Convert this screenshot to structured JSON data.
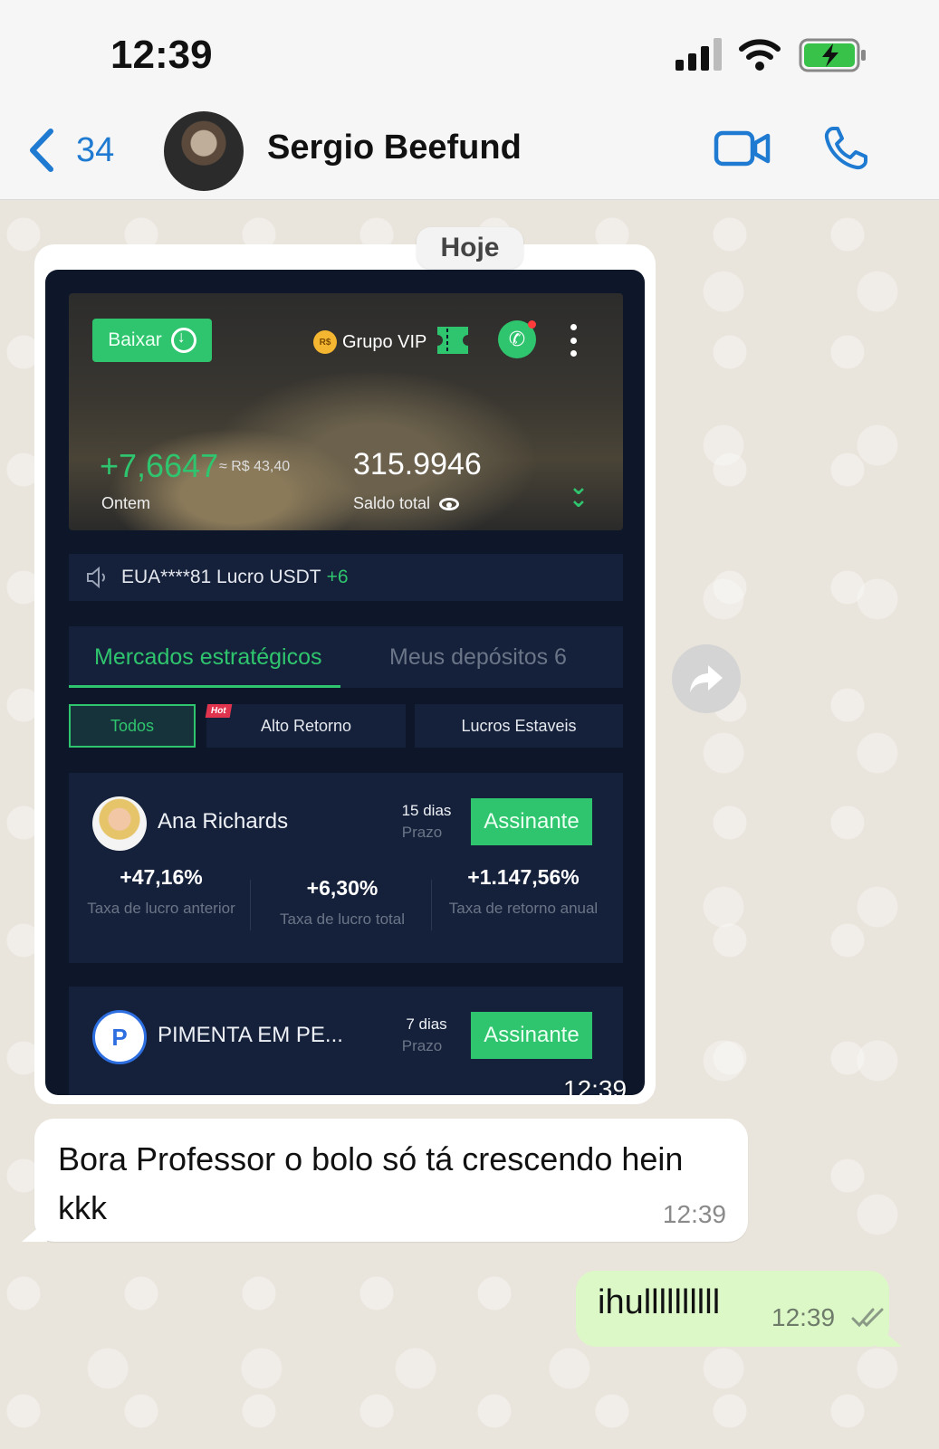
{
  "status_bar": {
    "time": "12:39"
  },
  "header": {
    "back_count": "34",
    "contact_name": "Sergio Beefund",
    "icons": [
      "chevron-left-icon",
      "video-call-icon",
      "phone-icon"
    ]
  },
  "date_divider": "Hoje",
  "image_message": {
    "time": "12:39",
    "screenshot": {
      "download_label": "Baixar",
      "vip_coin": "R$",
      "vip_label": "Grupo VIP",
      "profit_value": "+7,6647",
      "profit_brl": "≈ R$ 43,40",
      "profit_period": "Ontem",
      "balance_value": "315.9946",
      "balance_label": "Saldo total",
      "notice_text": "EUA****81 Lucro USDT",
      "notice_amount": "+6",
      "tabs": {
        "active": "Mercados estratégicos",
        "inactive": "Meus depósitos  6"
      },
      "filters": {
        "all": "Todos",
        "hot_badge": "Hot",
        "high_return": "Alto Retorno",
        "stable": "Lucros Estaveis"
      },
      "cards": [
        {
          "name": "Ana Richards",
          "days": "15 dias",
          "term_label": "Prazo",
          "button": "Assinante",
          "metrics": [
            {
              "value": "+47,16%",
              "label": "Taxa de lucro anterior"
            },
            {
              "value": "+6,30%",
              "label": "Taxa de lucro total"
            },
            {
              "value": "+1.147,56%",
              "label": "Taxa de retorno anual"
            }
          ]
        },
        {
          "name": "PIMENTA EM PE...",
          "avatar_letter": "P",
          "days": "7 dias",
          "term_label": "Prazo",
          "button": "Assinante"
        }
      ]
    }
  },
  "messages": [
    {
      "direction": "incoming",
      "text": "Bora Professor o bolo só tá crescendo hein kkk",
      "time": "12:39"
    },
    {
      "direction": "outgoing",
      "text": "ihullllllllll",
      "time": "12:39",
      "status": "read"
    }
  ],
  "colors": {
    "accent_blue": "#1f7ad1",
    "app_green": "#2fc56e",
    "outgoing_bubble": "#dcf8c6"
  }
}
